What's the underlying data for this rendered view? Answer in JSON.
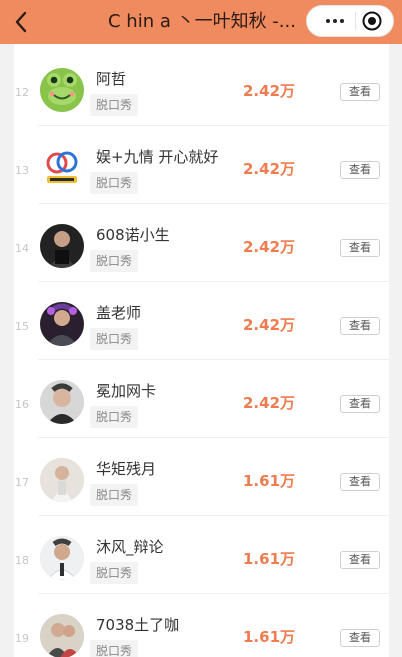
{
  "header": {
    "title": "C hin a 丶一叶知秋 -...",
    "back_icon": "chevron-left-icon",
    "more_icon": "more-dots-icon",
    "close_icon": "target-circle-icon",
    "bg_color": "#f08a5f"
  },
  "rows": [
    {
      "rank": "12",
      "name": "阿哲",
      "tag": "脱口秀",
      "value": "2.42万",
      "view_label": "查看",
      "avatar": "frog-avatar"
    },
    {
      "rank": "13",
      "name": "娱+九情 开心就好",
      "tag": "脱口秀",
      "value": "2.42万",
      "view_label": "查看",
      "avatar": "logo-avatar"
    },
    {
      "rank": "14",
      "name": "608诺小生",
      "tag": "脱口秀",
      "value": "2.42万",
      "view_label": "查看",
      "avatar": "person-avatar"
    },
    {
      "rank": "15",
      "name": "盖老师",
      "tag": "脱口秀",
      "value": "2.42万",
      "view_label": "查看",
      "avatar": "person-avatar"
    },
    {
      "rank": "16",
      "name": "冕加网卡",
      "tag": "脱口秀",
      "value": "2.42万",
      "view_label": "查看",
      "avatar": "person-avatar"
    },
    {
      "rank": "17",
      "name": "华矩残月",
      "tag": "脱口秀",
      "value": "1.61万",
      "view_label": "查看",
      "avatar": "person-avatar"
    },
    {
      "rank": "18",
      "name": "沐风_辩论",
      "tag": "脱口秀",
      "value": "1.61万",
      "view_label": "查看",
      "avatar": "person-avatar"
    },
    {
      "rank": "19",
      "name": "7038土了咖",
      "tag": "脱口秀",
      "value": "1.61万",
      "view_label": "查看",
      "avatar": "person-avatar"
    }
  ],
  "colors": {
    "accent": "#ef7c4f",
    "rank_text": "#c6c6c6",
    "tag_bg": "#f3f3f3"
  }
}
